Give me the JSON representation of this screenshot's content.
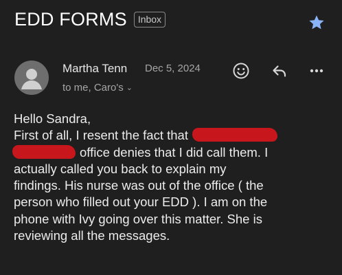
{
  "email": {
    "subject": "EDD FORMS",
    "folder_chip": "Inbox",
    "sender_name": "Martha Tenn",
    "date": "Dec 5, 2024",
    "recipients": "to me, Caro's",
    "body_lines": [
      "Hello Sandra,",
      "First of all, I resent the fact that",
      "office denies that I did call them. I",
      "actually called you back to explain my",
      "findings. His nurse was out of the office ( the",
      "person who filled out your EDD ). I am on the",
      "phone with Ivy going over this matter. She is",
      "reviewing all the messages."
    ]
  },
  "icons": {
    "star": "star-icon",
    "avatar": "avatar-placeholder-icon",
    "emoji": "emoji-reaction-icon",
    "reply": "reply-icon",
    "more": "more-options-icon",
    "expand": "chevron-down-icon"
  },
  "colors": {
    "background": "#1f1f1f",
    "star": "#8ab4f8",
    "redaction": "#c8161d"
  }
}
